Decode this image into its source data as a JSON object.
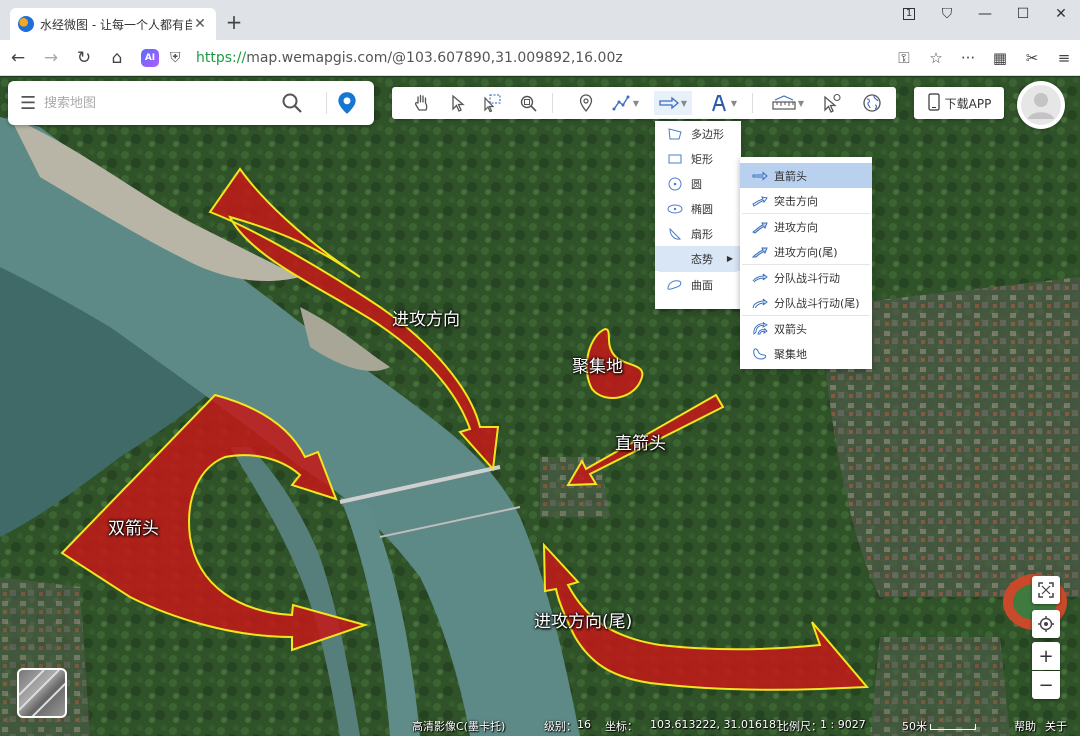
{
  "browser": {
    "tab_title": "水经微图 - 让每一个人都有自",
    "tab_close": "✕",
    "new_tab": "+",
    "url_https": "https://",
    "url_rest": "map.wemapgis.com/@103.607890,31.009892,16.00z",
    "ai_label": "AI",
    "window_buttons": [
      "1",
      "⛉",
      "—",
      "☐",
      "✕"
    ]
  },
  "search": {
    "placeholder": "搜索地图"
  },
  "header": {
    "download_label": "下载APP"
  },
  "draw_menu": {
    "items": [
      {
        "label": "多边形",
        "icon": "polygon-icon"
      },
      {
        "label": "矩形",
        "icon": "rectangle-icon"
      },
      {
        "label": "圆",
        "icon": "circle-icon"
      },
      {
        "label": "椭圆",
        "icon": "ellipse-icon"
      },
      {
        "label": "扇形",
        "icon": "sector-icon"
      },
      {
        "label": "态势",
        "icon": "",
        "submenu": true
      },
      {
        "label": "曲面",
        "icon": "curved-surface-icon"
      }
    ]
  },
  "situation_menu": {
    "items": [
      {
        "label": "直箭头",
        "icon": "straight-arrow-icon"
      },
      {
        "label": "突击方向",
        "icon": "assault-direction-icon"
      },
      {
        "label": "进攻方向",
        "icon": "attack-direction-icon"
      },
      {
        "label": "进攻方向(尾)",
        "icon": "attack-direction-tail-icon"
      },
      {
        "label": "分队战斗行动",
        "icon": "squad-action-icon"
      },
      {
        "label": "分队战斗行动(尾)",
        "icon": "squad-action-tail-icon"
      },
      {
        "label": "双箭头",
        "icon": "double-arrow-icon"
      },
      {
        "label": "聚集地",
        "icon": "gathering-place-icon"
      }
    ]
  },
  "map_labels": {
    "attack": "进攻方向",
    "gather": "聚集地",
    "straight": "直箭头",
    "double": "双箭头",
    "attack_tail": "进攻方向(尾)"
  },
  "status": {
    "layer": "高清影像C(墨卡托)",
    "level_label": "级别：",
    "level": "16",
    "coord_label": "坐标：",
    "coord": "103.613222, 31.016181",
    "scale_label": "比例尺：",
    "scale": "1 : 9027",
    "scale_bar": "50米",
    "help": "帮助",
    "about": "关于"
  },
  "colors": {
    "arrow_fill": "#c41717",
    "arrow_stroke": "#f2e61c",
    "url_green": "#1a9c3e",
    "pin_blue": "#1677d2"
  }
}
